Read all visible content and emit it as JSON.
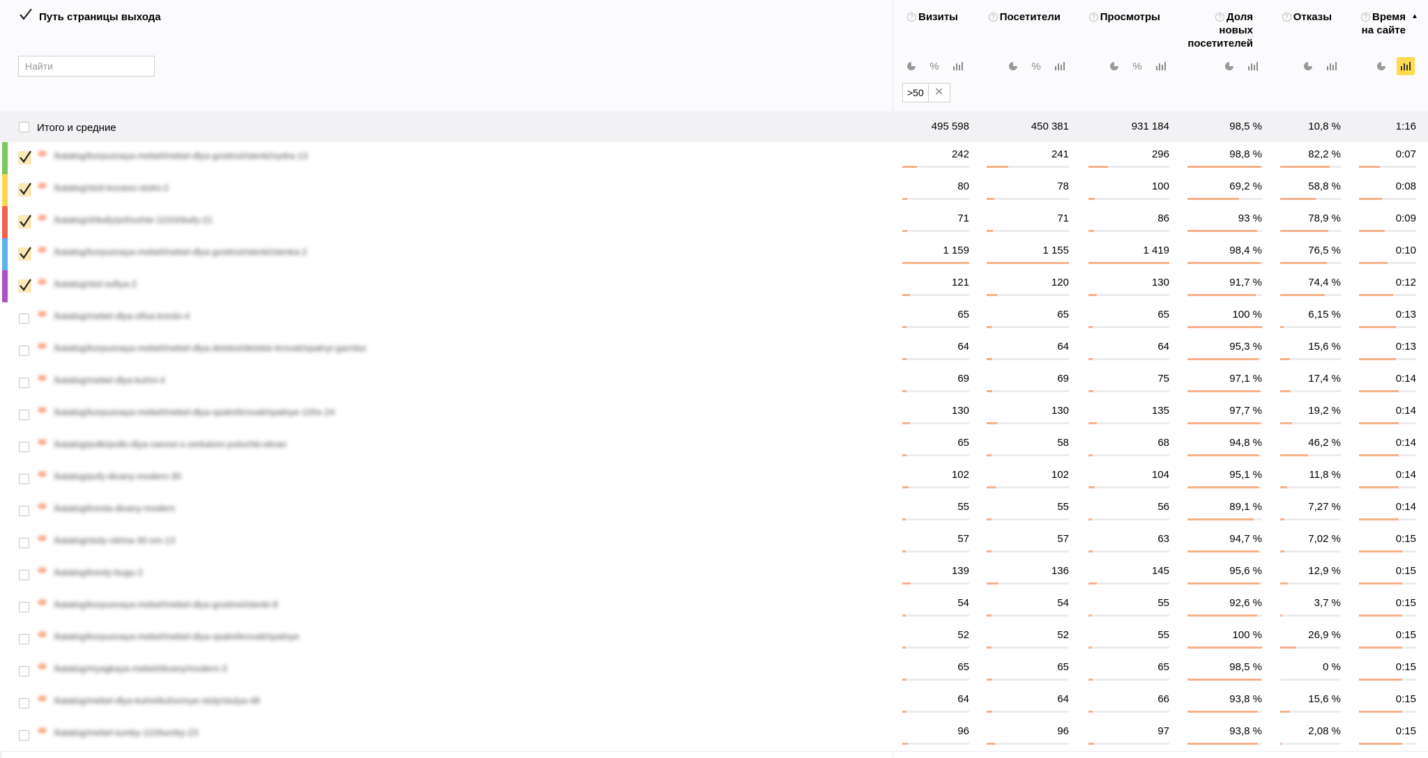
{
  "header": {
    "path_title": "Путь страницы выхода",
    "search_placeholder": "Найти",
    "filter_chip": ">50",
    "sort_arrow": "▲"
  },
  "columns": [
    {
      "key": "visits",
      "title_lines": [
        "Визиты"
      ],
      "controls": [
        "pie",
        "percent",
        "bars"
      ],
      "active": ""
    },
    {
      "key": "visitors",
      "title_lines": [
        "Посетители"
      ],
      "controls": [
        "pie",
        "percent",
        "bars"
      ],
      "active": ""
    },
    {
      "key": "views",
      "title_lines": [
        "Просмотры"
      ],
      "controls": [
        "pie",
        "percent",
        "bars"
      ],
      "active": ""
    },
    {
      "key": "new_share",
      "title_lines": [
        "Доля",
        "новых",
        "посетителей"
      ],
      "controls": [
        "pie",
        "bars"
      ],
      "active": ""
    },
    {
      "key": "bounces",
      "title_lines": [
        "Отказы"
      ],
      "controls": [
        "pie",
        "bars"
      ],
      "active": ""
    },
    {
      "key": "time",
      "title_lines": [
        "Время",
        "на сайте"
      ],
      "controls": [
        "pie",
        "bars"
      ],
      "active": "bars"
    }
  ],
  "totals": {
    "label": "Итого и средние",
    "values": [
      "495 598",
      "450 381",
      "931 184",
      "98,5 %",
      "10,8 %",
      "1:16"
    ]
  },
  "colors": {
    "stripes": [
      "#7ac95e",
      "#ffd54f",
      "#f4604e",
      "#5ab2f0",
      "#b14fcb"
    ],
    "bar_fill": "#f5b18a",
    "active_control": "#ffdb4d",
    "checked_box": "#fbe8b7"
  },
  "rows": [
    {
      "checked": true,
      "stripe": 0,
      "path": "/katalog/korpusnaya-mebel/mebel-dlya-gostinoi/stenki/vydra-13",
      "values": [
        "242",
        "241",
        "296",
        "98,8 %",
        "82,2 %",
        "0:07"
      ],
      "fills": [
        0.22,
        0.26,
        0.24,
        0.99,
        0.82,
        0.36
      ]
    },
    {
      "checked": true,
      "stripe": 1,
      "path": "/katalog/stoli-kovano-stolni-2",
      "values": [
        "80",
        "78",
        "100",
        "69,2 %",
        "58,8 %",
        "0:08"
      ],
      "fills": [
        0.07,
        0.09,
        0.08,
        0.69,
        0.59,
        0.4
      ]
    },
    {
      "checked": true,
      "stripe": 2,
      "path": "/katalog/shkafy/prihozhie-110/shkafy-21",
      "values": [
        "71",
        "71",
        "86",
        "93 %",
        "78,9 %",
        "0:09"
      ],
      "fills": [
        0.07,
        0.08,
        0.07,
        0.93,
        0.79,
        0.45
      ]
    },
    {
      "checked": true,
      "stripe": 3,
      "path": "/katalog/korpusnaya-mebel/mebel-dlya-gostinoi/stenki/stenka-2",
      "values": [
        "1 159",
        "1 155",
        "1 419",
        "98,4 %",
        "76,5 %",
        "0:10"
      ],
      "fills": [
        1.0,
        1.0,
        1.0,
        0.98,
        0.77,
        0.5
      ]
    },
    {
      "checked": true,
      "stripe": 4,
      "path": "/katalog/stol-sofiya-2",
      "values": [
        "121",
        "120",
        "130",
        "91,7 %",
        "74,4 %",
        "0:12"
      ],
      "fills": [
        0.11,
        0.13,
        0.1,
        0.92,
        0.74,
        0.6
      ]
    },
    {
      "checked": false,
      "stripe": null,
      "path": "/katalog/mebel-dlya-ofisa-kreslo-4",
      "values": [
        "65",
        "65",
        "65",
        "100 %",
        "6,15 %",
        "0:13"
      ],
      "fills": [
        0.06,
        0.07,
        0.05,
        1.0,
        0.06,
        0.65
      ]
    },
    {
      "checked": false,
      "stripe": null,
      "path": "/katalog/korpusnaya-mebel/mebel-dlya-detskoi/detskie-krovati/spalnyi-garnitur",
      "values": [
        "64",
        "64",
        "64",
        "95,3 %",
        "15,6 %",
        "0:13"
      ],
      "fills": [
        0.06,
        0.07,
        0.05,
        0.95,
        0.16,
        0.65
      ]
    },
    {
      "checked": false,
      "stripe": null,
      "path": "/katalog/mebel-dlya-kuhni-4",
      "values": [
        "69",
        "69",
        "75",
        "97,1 %",
        "17,4 %",
        "0:14"
      ],
      "fills": [
        0.06,
        0.07,
        0.06,
        0.97,
        0.17,
        0.7
      ]
    },
    {
      "checked": false,
      "stripe": null,
      "path": "/katalog/korpusnaya-mebel/mebel-dlya-spalni/krovati/spalnye-100x-24",
      "values": [
        "130",
        "130",
        "135",
        "97,7 %",
        "19,2 %",
        "0:14"
      ],
      "fills": [
        0.11,
        0.13,
        0.1,
        0.98,
        0.19,
        0.7
      ]
    },
    {
      "checked": false,
      "stripe": null,
      "path": "/katalog/polki/polki-dlya-vannoi-s-zerkalom-polochki-ekran",
      "values": [
        "65",
        "58",
        "68",
        "94,8 %",
        "46,2 %",
        "0:14"
      ],
      "fills": [
        0.06,
        0.06,
        0.05,
        0.95,
        0.46,
        0.7
      ]
    },
    {
      "checked": false,
      "stripe": null,
      "path": "/katalog/pufy-divany-modern-30",
      "values": [
        "102",
        "102",
        "104",
        "95,1 %",
        "11,8 %",
        "0:14"
      ],
      "fills": [
        0.09,
        0.11,
        0.08,
        0.95,
        0.12,
        0.7
      ]
    },
    {
      "checked": false,
      "stripe": null,
      "path": "/katalog/kresla-divany-modern",
      "values": [
        "55",
        "55",
        "56",
        "89,1 %",
        "7,27 %",
        "0:14"
      ],
      "fills": [
        0.05,
        0.06,
        0.04,
        0.89,
        0.07,
        0.7
      ]
    },
    {
      "checked": false,
      "stripe": null,
      "path": "/katalog/stoly-vitrina-30-sm-13",
      "values": [
        "57",
        "57",
        "63",
        "94,7 %",
        "7,02 %",
        "0:15"
      ],
      "fills": [
        0.05,
        0.06,
        0.05,
        0.95,
        0.07,
        0.75
      ]
    },
    {
      "checked": false,
      "stripe": null,
      "path": "/katalog/kresly-bugu-2",
      "values": [
        "139",
        "136",
        "145",
        "95,6 %",
        "12,9 %",
        "0:15"
      ],
      "fills": [
        0.12,
        0.14,
        0.1,
        0.96,
        0.13,
        0.75
      ]
    },
    {
      "checked": false,
      "stripe": null,
      "path": "/katalog/korpusnaya-mebel/mebel-dlya-gostinoi/stenki-8",
      "values": [
        "54",
        "54",
        "55",
        "92,6 %",
        "3,7 %",
        "0:15"
      ],
      "fills": [
        0.05,
        0.06,
        0.04,
        0.93,
        0.04,
        0.75
      ]
    },
    {
      "checked": false,
      "stripe": null,
      "path": "/katalog/korpusnaya-mebel/mebel-dlya-spalni/krovati/spalnye",
      "values": [
        "52",
        "52",
        "55",
        "100 %",
        "26,9 %",
        "0:15"
      ],
      "fills": [
        0.05,
        0.06,
        0.04,
        1.0,
        0.27,
        0.75
      ]
    },
    {
      "checked": false,
      "stripe": null,
      "path": "/katalog/myagkaya-mebel/divany/modern-3",
      "values": [
        "65",
        "65",
        "65",
        "98,5 %",
        "0 %",
        "0:15"
      ],
      "fills": [
        0.06,
        0.07,
        0.05,
        0.99,
        0.0,
        0.75
      ]
    },
    {
      "checked": false,
      "stripe": null,
      "path": "/katalog/mebel-dlya-kuhni/kuhonnye-stoly/stulya-48",
      "values": [
        "64",
        "64",
        "66",
        "93,8 %",
        "15,6 %",
        "0:15"
      ],
      "fills": [
        0.06,
        0.07,
        0.05,
        0.94,
        0.16,
        0.75
      ]
    },
    {
      "checked": false,
      "stripe": null,
      "path": "/katalog/mebel-tumby-110/tumby-23",
      "values": [
        "96",
        "96",
        "97",
        "93,8 %",
        "2,08 %",
        "0:15"
      ],
      "fills": [
        0.08,
        0.1,
        0.07,
        0.94,
        0.02,
        0.75
      ]
    }
  ]
}
